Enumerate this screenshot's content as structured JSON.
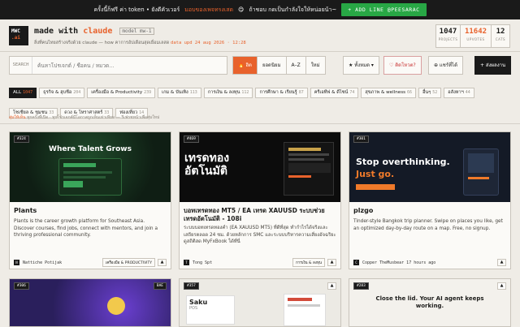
{
  "promo": {
    "text_before": "ครั้งนี้ก็ฟรี ค่า token • ยังดีคัวเวอร์",
    "highlight": "มอบของเพจทรงเสด",
    "emoji": "😋",
    "text_after": "ถ้าชอบ กดเป็นกำลังใจให้หน่อยน้า~",
    "button": "+ ADD LINE @PEESARAC"
  },
  "header": {
    "logo_top": "MWC",
    "logo_bottom": ".ai",
    "brand_prefix": "made with",
    "brand_name": "claude",
    "model_badge": "model mw-1",
    "tagline": "สิ่งที่คนไทยสร้างจริงด้วย claude — how คาการอัปเดือนสุดเยื่อมเลสด",
    "updated": "data upd 24 aug 2026 · 12:28",
    "stats": [
      {
        "value": "1047",
        "label": "PROJECTS"
      },
      {
        "value": "11642",
        "label": "UPVOTES"
      },
      {
        "value": "12",
        "label": "CATS"
      }
    ]
  },
  "search": {
    "label": "SEARCH",
    "placeholder": "ค้นหาโปรเจกต์ / ชื่อคน / หมวด...",
    "sort_options": [
      "🔥 ฮิต",
      "ยอดนิยม",
      "A–Z",
      "ใหม่"
    ],
    "filter_label": "★ ทั้งหมด ▾",
    "red_button": "♡ ติดโหวต?",
    "submit_button": "⊕ แชร์ที่ได้",
    "submit_main": "+ ส่งผลงาน"
  },
  "categories": [
    {
      "label": "ALL",
      "count": "1047",
      "active": true
    },
    {
      "label": "ธุรกิจ & ฮุบชีอ",
      "count": "204"
    },
    {
      "label": "เครื่องมือ & Productivity",
      "count": "239"
    },
    {
      "label": "เกม & บันเทิง",
      "count": "113"
    },
    {
      "label": "การเงิน & ลงทุน",
      "count": "112"
    },
    {
      "label": "การศึกษา & เรียนรู้",
      "count": "87"
    },
    {
      "label": "ครีเอทีฟ & ดีไซน์",
      "count": "74"
    },
    {
      "label": "สุขภาพ & wellness",
      "count": "66"
    },
    {
      "label": "อื่นๆ",
      "count": "52"
    },
    {
      "label": "อสังหาฯ",
      "count": "44"
    },
    {
      "label": "โซเชียล & ชุมชน",
      "count": "33"
    },
    {
      "label": "ดวง & โหราศาสตร์",
      "count": "33"
    },
    {
      "label": "ท่องเที่ยว",
      "count": "14"
    }
  ],
  "note": {
    "highlight": "สุ่มให้เห็น",
    "text": "ทุกครั้งที่เปิด · ทุกโปรเจกต์มีโอกาสถูกเห็นเท่าเทียม — รีเฟรชหน้าเพื่อสุ่มใหม่"
  },
  "cards": [
    {
      "id": "#324",
      "shot_headline": "Where Talent Grows",
      "title": "Plants",
      "desc": "Plants is the career growth platform for Southeast Asia. Discover courses, find jobs, connect with mentors, and join a thriving professional community.",
      "author": "Nattiche Potijak",
      "avatar": "N",
      "tag": "เครื่องมือ & PRODUCTIVITY",
      "votes": "▲"
    },
    {
      "id": "#469",
      "shot_headline": "เทรดทอง อัตโนมัติ",
      "title": "บอทเทรดทอง MT5 / EA เทรด XAUUSD ระบบช่วยเทรดอัตโนมัติ - 108i",
      "desc": "ระบบบอทเทรดทองคำ (EA XAUUSD MT5) ที่ดีที่สุด ทำกำไรได้จริงและเสถียรตลอด 24 ชม. ด้วยหลักการ SMC และระบบบริหารความเสี่ยงอัจฉริยะ ดูสถิติสด MyFxBook ได้ที่นี่",
      "author": "Tong Spt",
      "avatar": "T",
      "tag": "การเงิน & ลงทุน",
      "votes": "▲"
    },
    {
      "id": "#301",
      "shot_headline": "Stop overthinking.",
      "shot_headline2": "Just go.",
      "title": "plzgo",
      "desc": "Tinder-style Bangkok trip planner. Swipe on places you like, get an optimized day-by-day route on a map. Free, no signup.",
      "author": "Copper TheMusbear 17 hours ago",
      "avatar": "C",
      "tag": "",
      "votes": "▲"
    }
  ],
  "cards_row2": [
    {
      "id": "#306",
      "badge2": "BAE"
    },
    {
      "id": "#357",
      "title": "Saku",
      "sub": "POS"
    },
    {
      "id": "#283",
      "text": "Close the lid. Your AI agent keeps working."
    }
  ],
  "colors": {
    "accent": "#e8622c",
    "dark": "#1a1a1a",
    "background": "#efece6",
    "line_green": "#28a745"
  }
}
